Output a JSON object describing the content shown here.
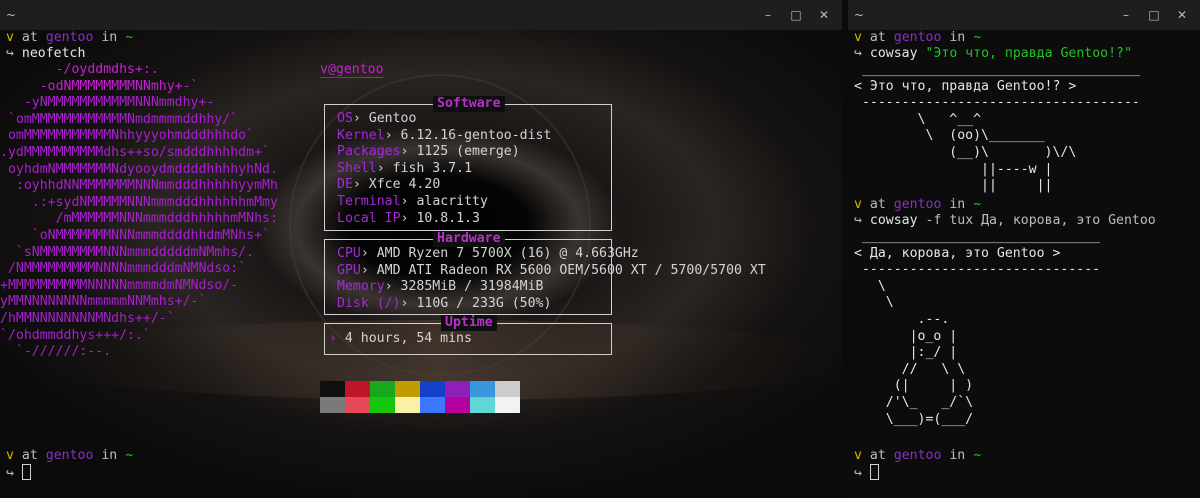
{
  "left_window": {
    "title": "~",
    "buttons": {
      "min": "–",
      "max": "□",
      "close": "✕"
    },
    "prompt1": {
      "user": "v",
      "at": "at",
      "host": "gentoo",
      "in": "in",
      "dir": "~",
      "arrow": "↪",
      "command": "neofetch"
    },
    "logo_lines": [
      "       -/oyddmdhs+:.",
      "     -odNMMMMMMMMNNmhy+-`",
      "   -yNMMMMMMMMMMMNNNmmdhy+-",
      " `omMMMMMMMMMMMMNmdmmmmddhhy/`",
      " omMMMMMMMMMMMNhhyyyohmdddhhhdo`",
      ".ydMMMMMMMMMMdhs++so/smdddhhhhdm+`",
      " oyhdmNMMMMMMMNdyooydmddddhhhhyhNd.",
      "  :oyhhdNNMMMMMMMNNNmmdddhhhhhyymMh",
      "    .:+sydNMMMMMNNNmmmdddhhhhhhmMmy",
      "       /mMMMMMMNNNmmmdddhhhhhmMNhs:",
      "    `oNMMMMMMMNNNmmmddddhhdmMNhs+`",
      "  `sNMMMMMMMMNNNmmmdddddmNMmhs/.",
      " /NMMMMMMMMMNNNNmmmdddmNMNdso:`",
      "+MMMMMMMMMMNNNNNmmmmdmNMNdso/-",
      "yMMNNNNNNNNmmmmmNNMmhs+/-`",
      "/hMMNNNNNNNNMNdhs++/-`",
      "`/ohdmmddhys+++/:.`",
      "  `-//////:--."
    ],
    "userhost": "v@gentoo",
    "underline": "‾‾‾‾‾‾‾‾",
    "software": {
      "label": "Software",
      "items": [
        {
          "key": "OS",
          "value": "Gentoo"
        },
        {
          "key": "Kernel",
          "value": "6.12.16-gentoo-dist"
        },
        {
          "key": "Packages",
          "value": "1125 (emerge)"
        },
        {
          "key": "Shell",
          "value": "fish 3.7.1"
        },
        {
          "key": "DE",
          "value": "Xfce 4.20"
        },
        {
          "key": "Terminal",
          "value": "alacritty"
        },
        {
          "key": "Local IP",
          "value": "10.8.1.3"
        }
      ]
    },
    "hardware": {
      "label": "Hardware",
      "items": [
        {
          "key": "CPU",
          "value": "AMD Ryzen 7 5700X (16) @ 4.663GHz"
        },
        {
          "key": "GPU",
          "value": "AMD ATI Radeon RX 5600 OEM/5600 XT / 5700/5700 XT"
        },
        {
          "key": "Memory",
          "value": "3285MiB / 31984MiB"
        },
        {
          "key": "Disk (/)",
          "value": "110G / 233G (50%)"
        }
      ]
    },
    "uptime": {
      "label": "Uptime",
      "value": "4 hours, 54 mins"
    },
    "sep": "›",
    "palette_top": [
      "#0f0f10",
      "#c0142a",
      "#17a81c",
      "#c19c00",
      "#1342c9",
      "#8c20b8",
      "#3a96dd",
      "#cccccc"
    ],
    "palette_bottom": [
      "#7a7a7a",
      "#e74856",
      "#16c60c",
      "#f9f1a5",
      "#3b78ff",
      "#b4009e",
      "#61d6d6",
      "#f2f2f2"
    ],
    "prompt2": {
      "user": "v",
      "at": "at",
      "host": "gentoo",
      "in": "in",
      "dir": "~",
      "arrow": "↪"
    }
  },
  "right_window": {
    "title": "~",
    "buttons": {
      "min": "–",
      "max": "□",
      "close": "✕"
    },
    "prompt1": {
      "user": "v",
      "at": "at",
      "host": "gentoo",
      "in": "in",
      "dir": "~",
      "arrow": "↪",
      "command": "cowsay",
      "arg": "\"Это что, правда Gentoo!?\""
    },
    "cow1_lines": [
      " ___________________________________",
      "< Это что, правда Gentoo!? >",
      " -----------------------------------",
      "        \\   ^__^",
      "         \\  (oo)\\_______",
      "            (__)\\       )\\/\\",
      "                ||----w |",
      "                ||     ||"
    ],
    "prompt2": {
      "user": "v",
      "at": "at",
      "host": "gentoo",
      "in": "in",
      "dir": "~",
      "arrow": "↪",
      "command": "cowsay",
      "arg": "-f tux Да, корова, это Gentoo"
    },
    "tux_lines": [
      " ______________________________",
      "< Да, корова, это Gentoo >",
      " ------------------------------",
      "   \\",
      "    \\",
      "        .--.",
      "       |o_o |",
      "       |:_/ |",
      "      //   \\ \\",
      "     (|     | )",
      "    /'\\_   _/`\\",
      "    \\___)=(___/"
    ],
    "prompt3": {
      "user": "v",
      "at": "at",
      "host": "gentoo",
      "in": "in",
      "dir": "~",
      "arrow": "↪"
    }
  }
}
